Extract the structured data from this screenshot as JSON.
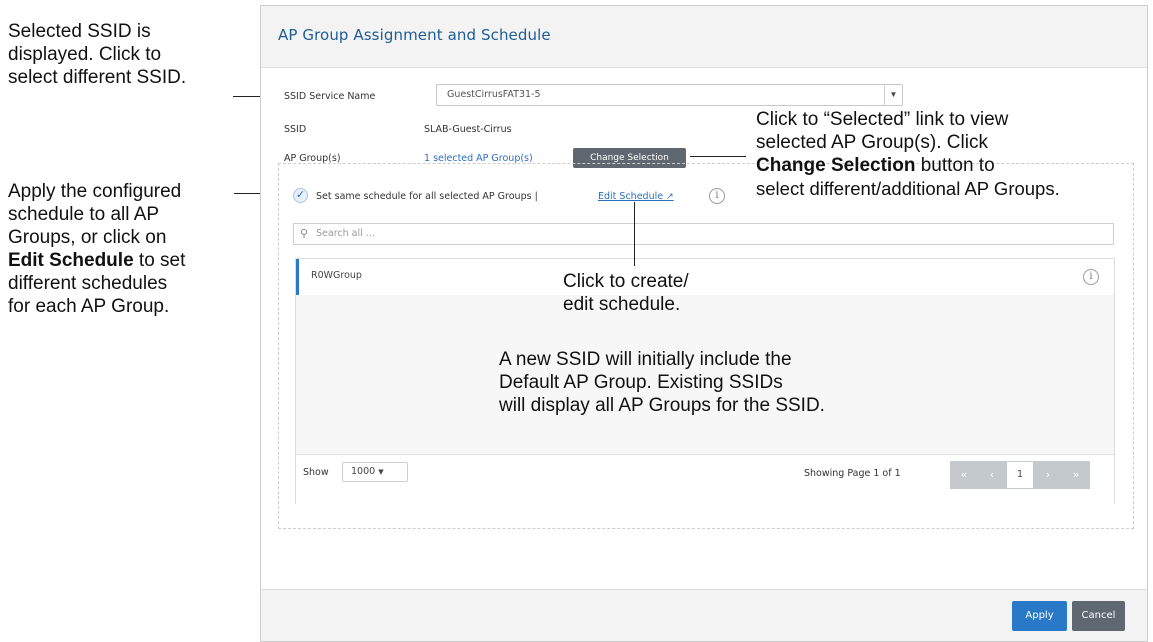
{
  "annotations": {
    "ssid_callout": [
      "Selected SSID is",
      "displayed. Click to",
      "select different SSID."
    ],
    "schedule_callout": [
      "Apply the configured",
      "schedule to all AP",
      "Groups, or click on"
    ],
    "schedule_callout_bold": "Edit Schedule",
    "schedule_callout_tail_a": " to set",
    "schedule_callout_rest": [
      "different schedules",
      "for each AP Group."
    ],
    "selected_callout_lines": [
      "Click to “Selected” link to view",
      "selected AP Group(s). Click"
    ],
    "selected_callout_bold": "Change Selection",
    "selected_callout_tail": " button to",
    "selected_callout_last": "select different/additional AP Groups.",
    "edit_schedule_callout": [
      "Click to create/",
      "edit schedule."
    ],
    "new_ssid_callout": [
      "A new SSID will initially include the",
      "Default AP Group. Existing SSIDs",
      "will display all AP Groups for the SSID."
    ]
  },
  "panel": {
    "title": "AP Group Assignment and Schedule"
  },
  "fields": {
    "ssid_service_name_label": "SSID Service Name",
    "ssid_service_name_value": "GuestCirrusFAT31-5",
    "ssid_label": "SSID",
    "ssid_value": "SLAB-Guest-Cirrus",
    "ap_groups_label": "AP Group(s)",
    "ap_groups_link": "1 selected AP Group(s)",
    "change_selection_button": "Change Selection"
  },
  "schedule": {
    "checkbox_label": "Set same schedule for all selected AP Groups |",
    "edit_schedule_link": "Edit Schedule",
    "checked": true
  },
  "search": {
    "placeholder": "Search all ..."
  },
  "list": {
    "items": [
      {
        "name": "R0WGroup"
      }
    ]
  },
  "pagination": {
    "show_label": "Show",
    "page_size": "1000",
    "status": "Showing Page 1 of 1",
    "current_page": "1",
    "first": "«",
    "prev": "‹",
    "next": "›",
    "last": "»"
  },
  "footer": {
    "apply": "Apply",
    "cancel": "Cancel"
  },
  "colors": {
    "title": "#1f5d96",
    "link": "#2a6fbf",
    "primary_button": "#2a78c8",
    "secondary_button": "#5f6870"
  },
  "icons": [
    "chevron-down-icon",
    "check-icon",
    "external-link-icon",
    "info-icon",
    "search-icon"
  ]
}
